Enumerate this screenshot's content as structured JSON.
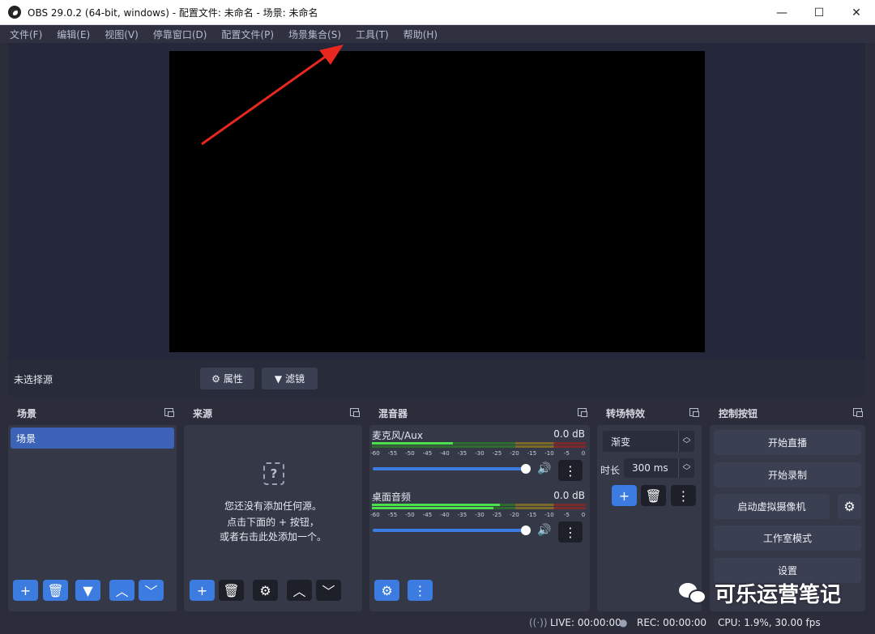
{
  "window": {
    "title": "OBS 29.0.2 (64-bit, windows) - 配置文件: 未命名 - 场景: 未命名",
    "minimize": "—",
    "maximize": "☐",
    "close": "✕"
  },
  "menu": [
    "文件(F)",
    "编辑(E)",
    "视图(V)",
    "停靠窗口(D)",
    "配置文件(P)",
    "场景集合(S)",
    "工具(T)",
    "帮助(H)"
  ],
  "source_bar": {
    "no_source": "未选择源",
    "properties": "属性",
    "filters": "滤镜"
  },
  "scenes": {
    "title": "场景",
    "items": [
      "场景"
    ]
  },
  "sources": {
    "title": "来源",
    "empty_line1": "您还没有添加任何源。",
    "empty_line2": "点击下面的 + 按钮，",
    "empty_line3": "或者右击此处添加一个。"
  },
  "mixer": {
    "title": "混音器",
    "channels": [
      {
        "name": "麦克风/Aux",
        "db": "0.0 dB",
        "level": 0.38
      },
      {
        "name": "桌面音频",
        "db": "0.0 dB",
        "level": 0.6
      }
    ],
    "scale": [
      "-60",
      "-55",
      "-50",
      "-45",
      "-40",
      "-35",
      "-30",
      "-25",
      "-20",
      "-15",
      "-10",
      "-5",
      "0"
    ]
  },
  "transitions": {
    "title": "转场特效",
    "type": "渐变",
    "duration_label": "时长",
    "duration_value": "300 ms"
  },
  "controls": {
    "title": "控制按钮",
    "start_streaming": "开始直播",
    "start_recording": "开始录制",
    "start_virtual_cam": "启动虚拟摄像机",
    "studio_mode": "工作室模式",
    "settings": "设置"
  },
  "status": {
    "live": "LIVE: 00:00:00",
    "rec": "REC: 00:00:00",
    "cpu": "CPU: 1.9%, 30.00 fps"
  },
  "watermark": "可乐运营笔记",
  "colors": {
    "accent": "#3c7be0",
    "annotation": "#e8281e"
  }
}
